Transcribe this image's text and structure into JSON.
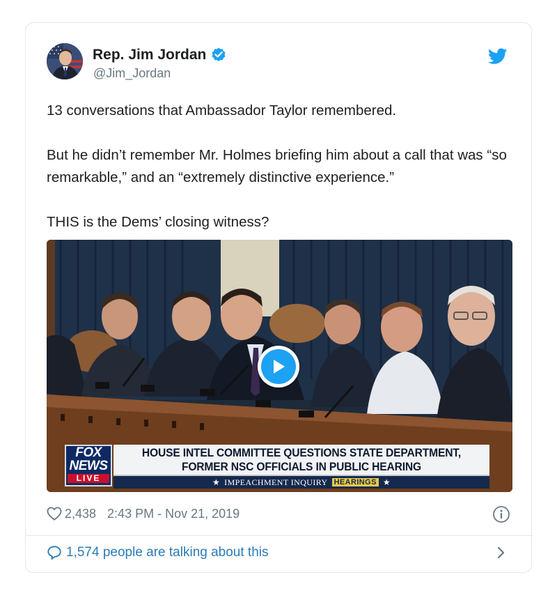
{
  "author": {
    "name": "Rep. Jim Jordan",
    "handle": "@Jim_Jordan",
    "verified": true
  },
  "tweet": {
    "paragraphs": [
      "13 conversations that Ambassador Taylor remembered.",
      "But he didn’t remember Mr. Holmes briefing him about a call that was “so remarkable,” and an “extremely distinctive experience.”",
      "THIS is the Dems’ closing witness?"
    ]
  },
  "media": {
    "chyron_line1": "HOUSE INTEL COMMITTEE QUESTIONS STATE DEPARTMENT,",
    "chyron_line2": "FORMER NSC OFFICIALS IN PUBLIC HEARING",
    "sub_banner_text": "IMPEACHMENT INQUIRY",
    "sub_banner_tag": "HEARINGS",
    "logo_line1": "FOX",
    "logo_line2": "NEWS",
    "logo_live": "LIVE"
  },
  "meta": {
    "likes": "2,438",
    "timestamp": "2:43 PM - Nov 21, 2019"
  },
  "footer": {
    "talking_text": "1,574 people are talking about this"
  },
  "colors": {
    "link": "#2b7bb9",
    "twitter_blue": "#1da1f2",
    "muted": "#697882",
    "text": "#1c2022"
  },
  "icons": [
    "verified-badge-icon",
    "twitter-bird-icon",
    "play-icon",
    "heart-icon",
    "info-icon",
    "comment-icon",
    "chevron-right-icon"
  ]
}
